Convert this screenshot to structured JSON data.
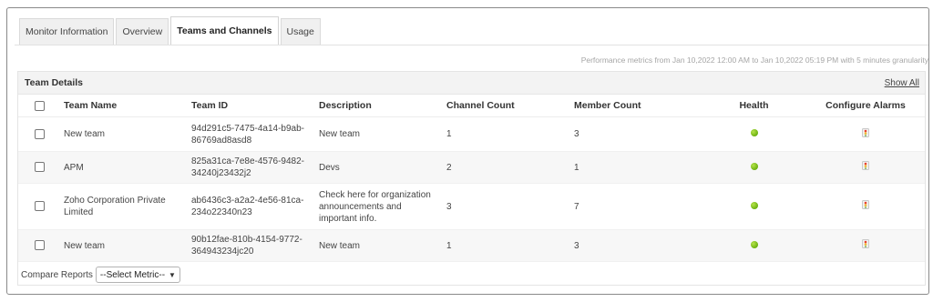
{
  "tabs": [
    {
      "label": "Monitor Information",
      "active": false
    },
    {
      "label": "Overview",
      "active": false
    },
    {
      "label": "Teams and Channels",
      "active": true
    },
    {
      "label": "Usage",
      "active": false
    }
  ],
  "performance_note": "Performance metrics from Jan 10,2022 12:00 AM to Jan 10,2022 05:19 PM with 5 minutes granularity",
  "panel": {
    "title": "Team Details",
    "show_all": "Show All"
  },
  "table": {
    "columns": [
      "",
      "Team Name",
      "Team ID",
      "Description",
      "Channel Count",
      "Member Count",
      "Health",
      "Configure Alarms"
    ],
    "rows": [
      {
        "team_name": "New team",
        "team_id": "94d291c5-7475-4a14-b9ab-86769ad8asd8",
        "description": "New team",
        "channel_count": "1",
        "member_count": "3",
        "health": "green",
        "alarm_icon": "alarm-icon"
      },
      {
        "team_name": "APM",
        "team_id": "825a31ca-7e8e-4576-9482-34240j23432j2",
        "description": "Devs",
        "channel_count": "2",
        "member_count": "1",
        "health": "green",
        "alarm_icon": "alarm-icon"
      },
      {
        "team_name": "Zoho Corporation Private Limited",
        "team_id": "ab6436c3-a2a2-4e56-81ca-234o22340n23",
        "description": "Check here for organization announcements and important info.",
        "channel_count": "3",
        "member_count": "7",
        "health": "green",
        "alarm_icon": "alarm-icon"
      },
      {
        "team_name": "New team",
        "team_id": "90b12fae-810b-4154-9772-364943234jc20",
        "description": "New team",
        "channel_count": "1",
        "member_count": "3",
        "health": "green",
        "alarm_icon": "alarm-icon"
      }
    ]
  },
  "footer": {
    "compare_label": "Compare Reports",
    "select_value": "--Select Metric--"
  },
  "colors": {
    "health_green": "#6bb10f",
    "alarm_red": "#e8402f",
    "alarm_yellow": "#f2b632",
    "alarm_green": "#5aa02c"
  }
}
